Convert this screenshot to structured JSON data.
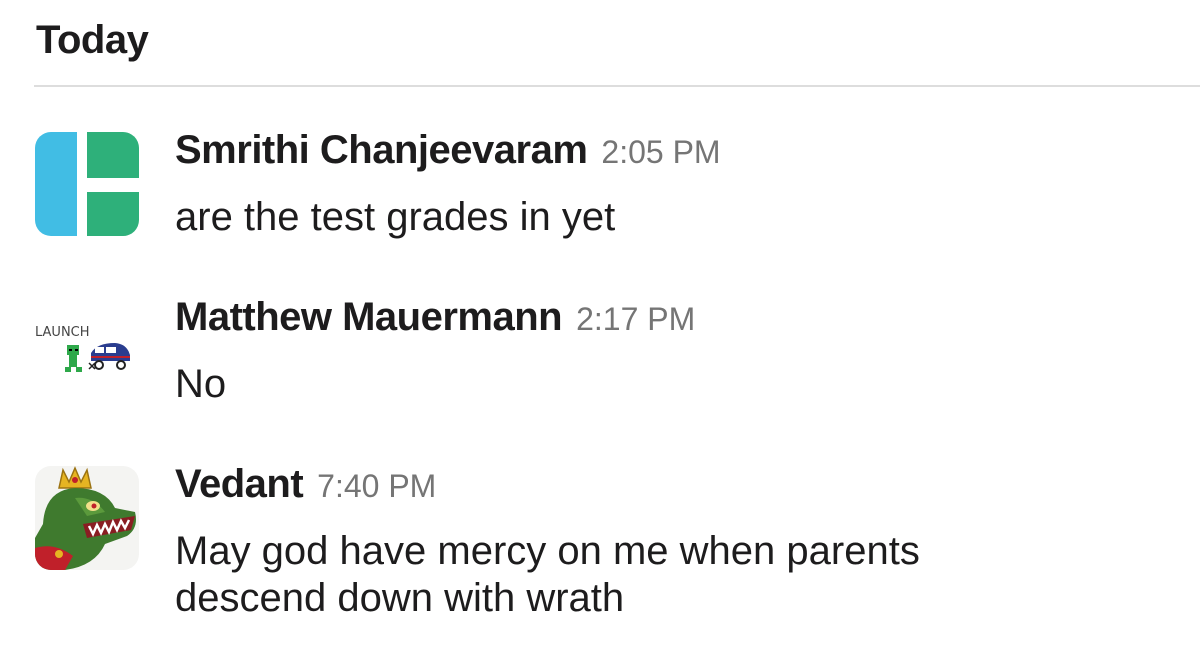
{
  "day_divider": {
    "label": "Today"
  },
  "messages": [
    {
      "sender": "Smrithi Chanjeevaram",
      "time": "2:05 PM",
      "lines": [
        "are the test grades in yet"
      ],
      "avatar": "blue-green-block-logo-icon"
    },
    {
      "sender": "Matthew Mauermann",
      "time": "2:17 PM",
      "lines": [
        "No"
      ],
      "avatar": "launch-doodle-icon",
      "avatar_text": "LAUNCH"
    },
    {
      "sender": "Vedant",
      "time": "7:40 PM",
      "lines": [
        "May god have mercy on me when parents",
        "descend down with wrath"
      ],
      "avatar": "crocodile-king-icon"
    }
  ],
  "colors": {
    "text": "#1d1c1d",
    "timestamp": "#757575",
    "divider": "#dddddd",
    "avatar_blue": "#41bde4",
    "avatar_green": "#2eb07a"
  }
}
